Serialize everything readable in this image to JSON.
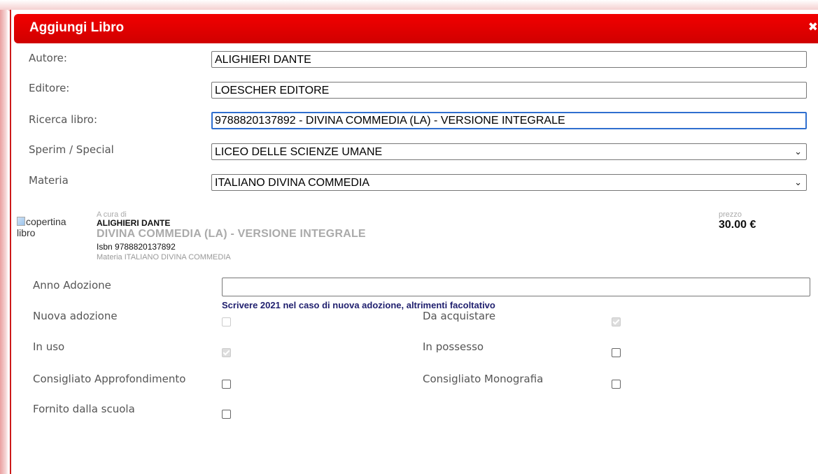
{
  "dialog": {
    "title": "Aggiungi Libro",
    "close_icon": "close-icon",
    "colors": {
      "titlebar": "#e60000",
      "title_text": "#ffffff",
      "hint": "#1f1f6e"
    }
  },
  "form": {
    "autore": {
      "label": "Autore:",
      "value": "ALIGHIERI DANTE"
    },
    "editore": {
      "label": "Editore:",
      "value": "LOESCHER EDITORE"
    },
    "ricerca": {
      "label": "Ricerca libro:",
      "value": "9788820137892 - DIVINA COMMEDIA (LA) - VERSIONE INTEGRALE"
    },
    "sperim": {
      "label": "Sperim / Special",
      "value": "LICEO DELLE SCIENZE UMANE"
    },
    "materia": {
      "label": "Materia",
      "value": "ITALIANO DIVINA COMMEDIA"
    }
  },
  "book": {
    "cover_alt": "copertina libro",
    "curator_prefix": "A cura di",
    "author": "ALIGHIERI DANTE",
    "title": "DIVINA COMMEDIA (LA) - VERSIONE INTEGRALE",
    "isbn": "Isbn 9788820137892",
    "materia": "Materia ITALIANO DIVINA COMMEDIA",
    "price_label": "prezzo",
    "price": "30.00 €"
  },
  "adozione": {
    "anno_label": "Anno Adozione",
    "anno_value": "",
    "hint": "Scrivere 2021 nel caso di nuova adozione, altrimenti facoltativo"
  },
  "checks": {
    "nuova_adozione": {
      "label": "Nuova adozione",
      "checked": false,
      "disabled": true
    },
    "da_acquistare": {
      "label": "Da acquistare",
      "checked": true,
      "disabled": true
    },
    "in_uso": {
      "label": "In uso",
      "checked": true,
      "disabled": true
    },
    "in_possesso": {
      "label": "In possesso",
      "checked": false,
      "disabled": false
    },
    "consigliato_approfondimento": {
      "label": "Consigliato Approfondimento",
      "checked": false,
      "disabled": false
    },
    "consigliato_monografia": {
      "label": "Consigliato Monografia",
      "checked": false,
      "disabled": false
    },
    "fornito_scuola": {
      "label": "Fornito dalla scuola",
      "checked": false,
      "disabled": false
    }
  }
}
